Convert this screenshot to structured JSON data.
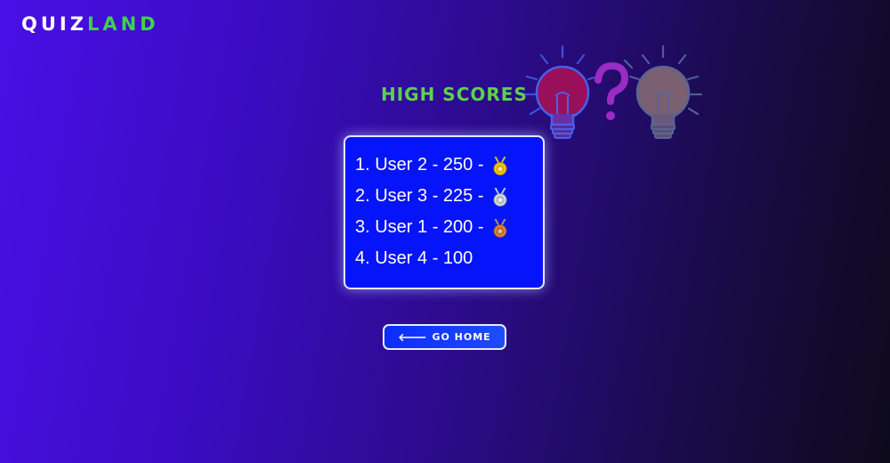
{
  "brand": {
    "part1": "QUIZ",
    "part2": "LAND",
    "accent_color": "#3fd24a"
  },
  "page": {
    "title": "HIGH SCORES"
  },
  "scores": [
    {
      "text": "1. User 2 - 250 -",
      "medal": "gold-medal-icon"
    },
    {
      "text": "2. User 3 - 225 -",
      "medal": "silver-medal-icon"
    },
    {
      "text": "3. User 1 - 200 -",
      "medal": "bronze-medal-icon"
    },
    {
      "text": "4. User 4 - 100",
      "medal": ""
    }
  ],
  "actions": {
    "home_arrow": "🡐",
    "home_label": "GO HOME"
  },
  "colors": {
    "card_bg": "#0614fb",
    "title": "#5fd14e",
    "button": "#0b2cff"
  }
}
